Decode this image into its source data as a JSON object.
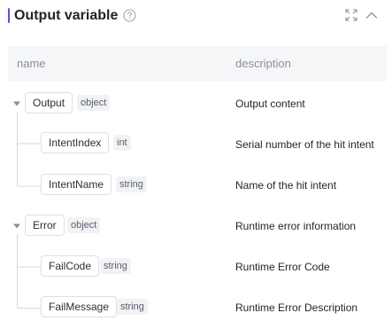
{
  "panel": {
    "title": "Output variable",
    "accent_color": "#4d53e8",
    "icons": [
      "help-circle-icon",
      "expand-icon",
      "chevron-up-icon"
    ]
  },
  "table": {
    "columns": [
      "name",
      "description"
    ],
    "rows": [
      {
        "name": "Output",
        "type": "object",
        "description": "Output content",
        "depth": 0,
        "expanded": true
      },
      {
        "name": "IntentIndex",
        "type": "int",
        "description": "Serial number of the hit intent",
        "depth": 1
      },
      {
        "name": "IntentName",
        "type": "string",
        "description": "Name of the hit intent",
        "depth": 1
      },
      {
        "name": "Error",
        "type": "object",
        "description": "Runtime error information",
        "depth": 0,
        "expanded": true
      },
      {
        "name": "FailCode",
        "type": "string",
        "description": "Runtime Error Code",
        "depth": 1
      },
      {
        "name": "FailMessage",
        "type": "string",
        "description": "Runtime Error Description",
        "depth": 1
      }
    ]
  }
}
